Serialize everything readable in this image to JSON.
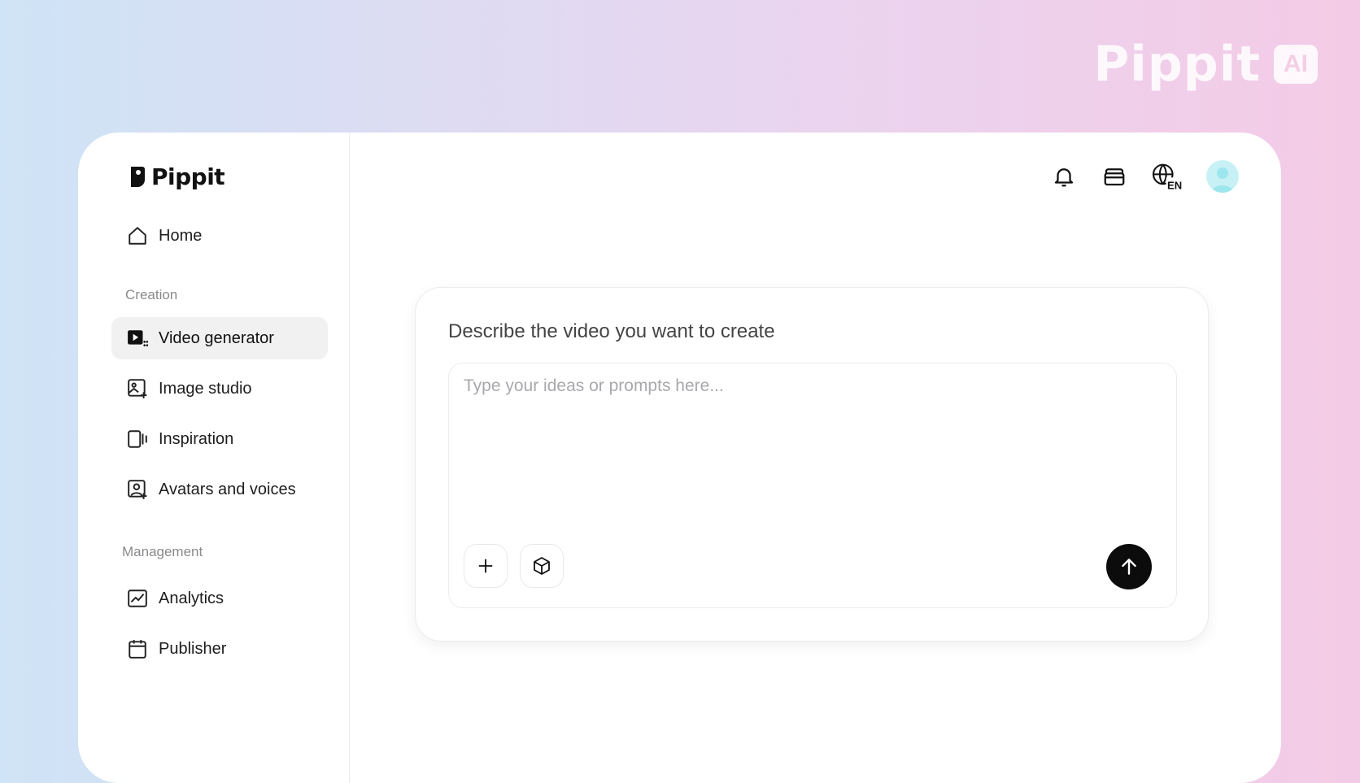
{
  "watermark": {
    "brand": "Pippit",
    "badge": "AI"
  },
  "sidebar": {
    "logo_text": "Pippit",
    "home": {
      "label": "Home",
      "icon": "home-icon"
    },
    "sections": [
      {
        "label": "Creation",
        "items": [
          {
            "label": "Video generator",
            "icon": "video-generator-icon",
            "active": true
          },
          {
            "label": "Image studio",
            "icon": "image-studio-icon"
          },
          {
            "label": "Inspiration",
            "icon": "inspiration-icon"
          },
          {
            "label": "Avatars and voices",
            "icon": "avatar-voice-icon"
          }
        ]
      },
      {
        "label": "Management",
        "items": [
          {
            "label": "Analytics",
            "icon": "analytics-icon"
          },
          {
            "label": "Publisher",
            "icon": "calendar-icon"
          }
        ]
      }
    ]
  },
  "header": {
    "icons": [
      "bell-icon",
      "credits-icon",
      "language-icon",
      "avatar"
    ],
    "language_code": "EN"
  },
  "composer": {
    "title": "Describe the video you want to create",
    "placeholder": "Type your ideas or prompts here...",
    "value": "",
    "buttons": [
      "add-icon",
      "cube-icon",
      "send-arrow-icon"
    ]
  },
  "colors": {
    "accent": "#0c0c0c",
    "active_bg": "#f1f1f2",
    "avatar": "#c8f1f5"
  }
}
